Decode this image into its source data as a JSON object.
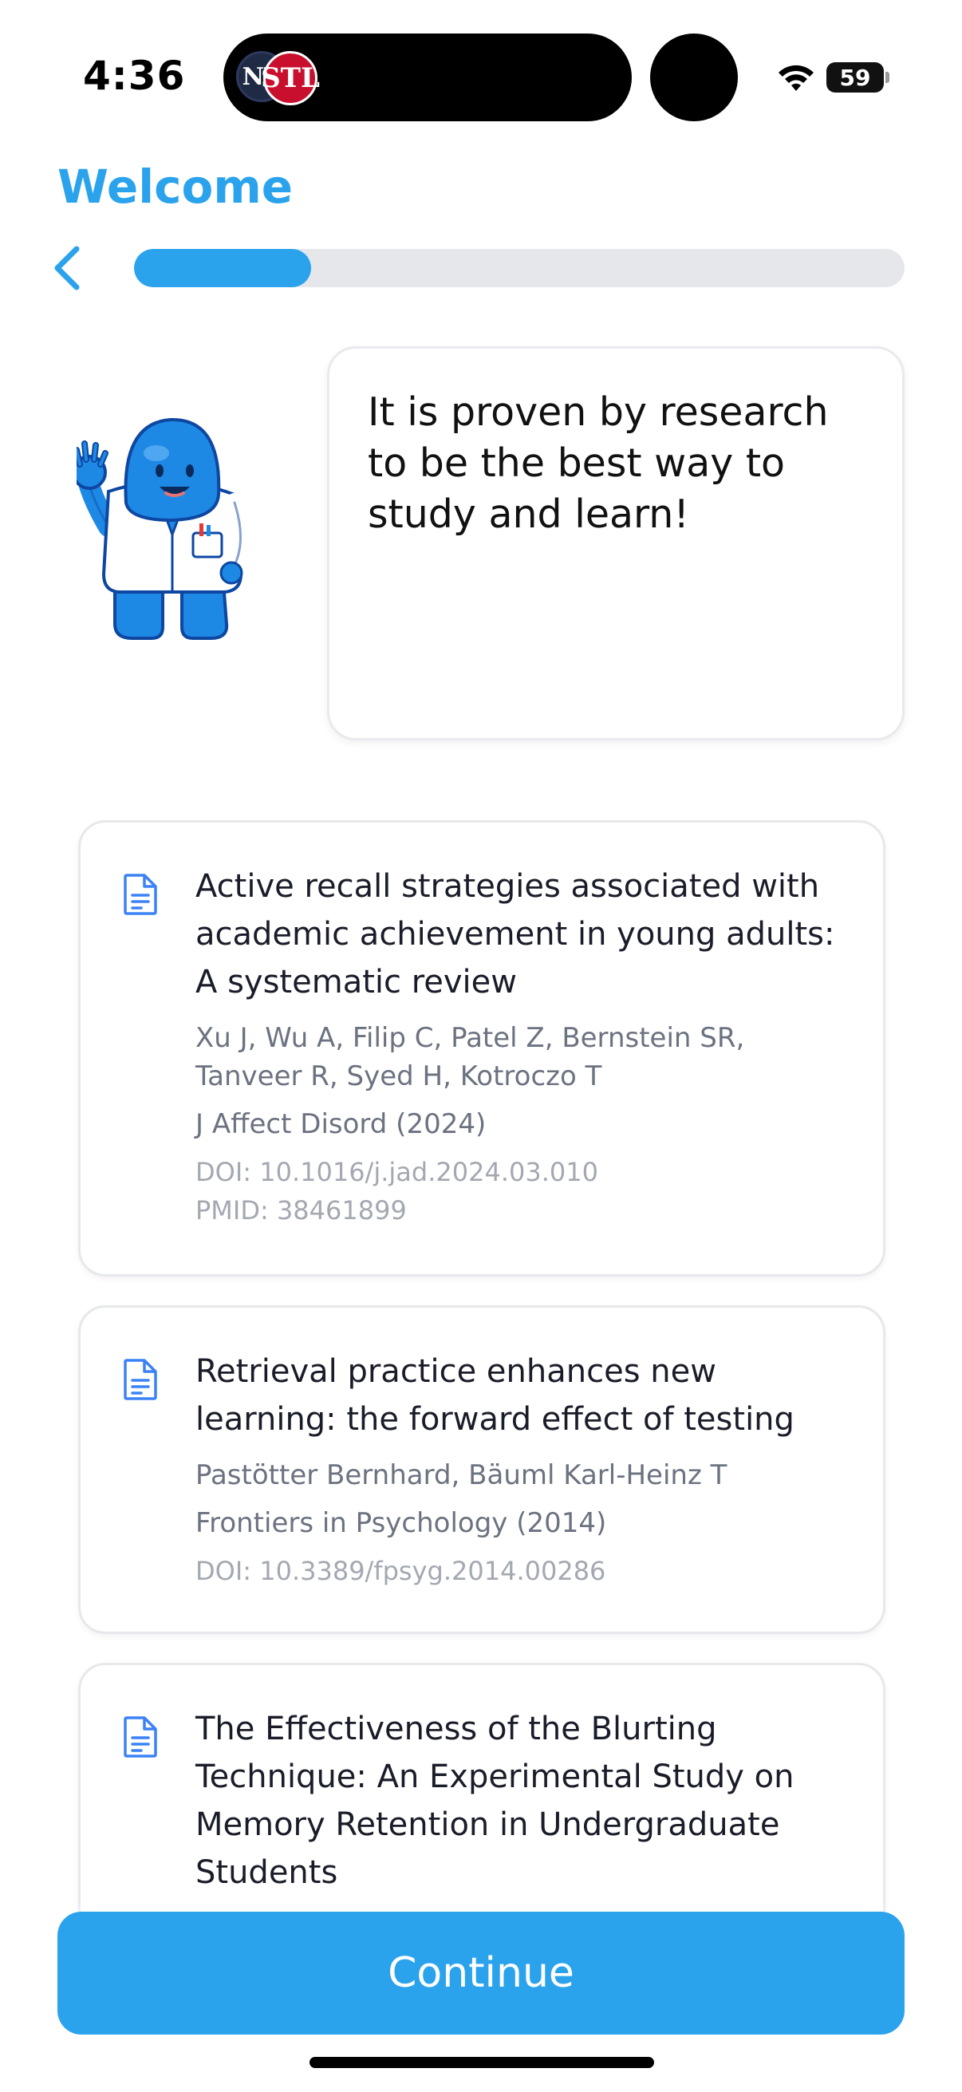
{
  "status_bar": {
    "time": "4:36",
    "battery": "59",
    "live_activity_logos": [
      "NY",
      "STL"
    ]
  },
  "header": {
    "title": "Welcome",
    "progress": 0.23
  },
  "speech_bubble": {
    "text": "It is proven by research to be the best way to study and learn!"
  },
  "references": [
    {
      "title": "Active recall strategies associated with academic achievement in young adults: A systematic review",
      "authors": "Xu J, Wu A, Filip C, Patel Z, Bernstein SR, Tanveer R, Syed H, Kotroczo T",
      "journal": "J Affect Disord (2024)",
      "doi": "DOI: 10.1016/j.jad.2024.03.010",
      "pmid": "PMID: 38461899"
    },
    {
      "title": "Retrieval practice enhances new learning: the forward effect of testing",
      "authors": "Pastötter Bernhard, Bäuml Karl-Heinz T",
      "journal": "Frontiers in Psychology (2014)",
      "doi": "DOI: 10.3389/fpsyg.2014.00286"
    },
    {
      "title": "The Effectiveness of the Blurting Technique: An Experimental Study on Memory Retention in Undergraduate Students"
    }
  ],
  "continue_label": "Continue",
  "colors": {
    "accent": "#2ba3ec",
    "track": "#e5e7eb",
    "mascot": "#1e88e5"
  }
}
